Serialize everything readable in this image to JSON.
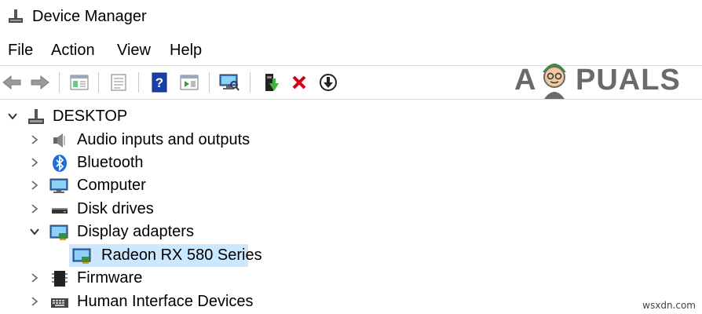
{
  "window": {
    "title": "Device Manager"
  },
  "menu": {
    "file": "File",
    "action": "Action",
    "view": "View",
    "help": "Help"
  },
  "watermark": {
    "left": "A",
    "right": "PUALS"
  },
  "tree": {
    "root": "DESKTOP",
    "items": [
      {
        "label": "Audio inputs and outputs",
        "expanded": false
      },
      {
        "label": "Bluetooth",
        "expanded": false
      },
      {
        "label": "Computer",
        "expanded": false
      },
      {
        "label": "Disk drives",
        "expanded": false
      },
      {
        "label": "Display adapters",
        "expanded": true
      },
      {
        "label": "Radeon RX 580 Series",
        "selected": true
      },
      {
        "label": "Firmware",
        "expanded": false
      },
      {
        "label": "Human Interface Devices",
        "expanded": false
      }
    ]
  },
  "footer": {
    "site": "wsxdn.com"
  },
  "colors": {
    "selection": "#cce8ff",
    "delete_red": "#d0021b",
    "help_blue": "#1a3fa8"
  }
}
